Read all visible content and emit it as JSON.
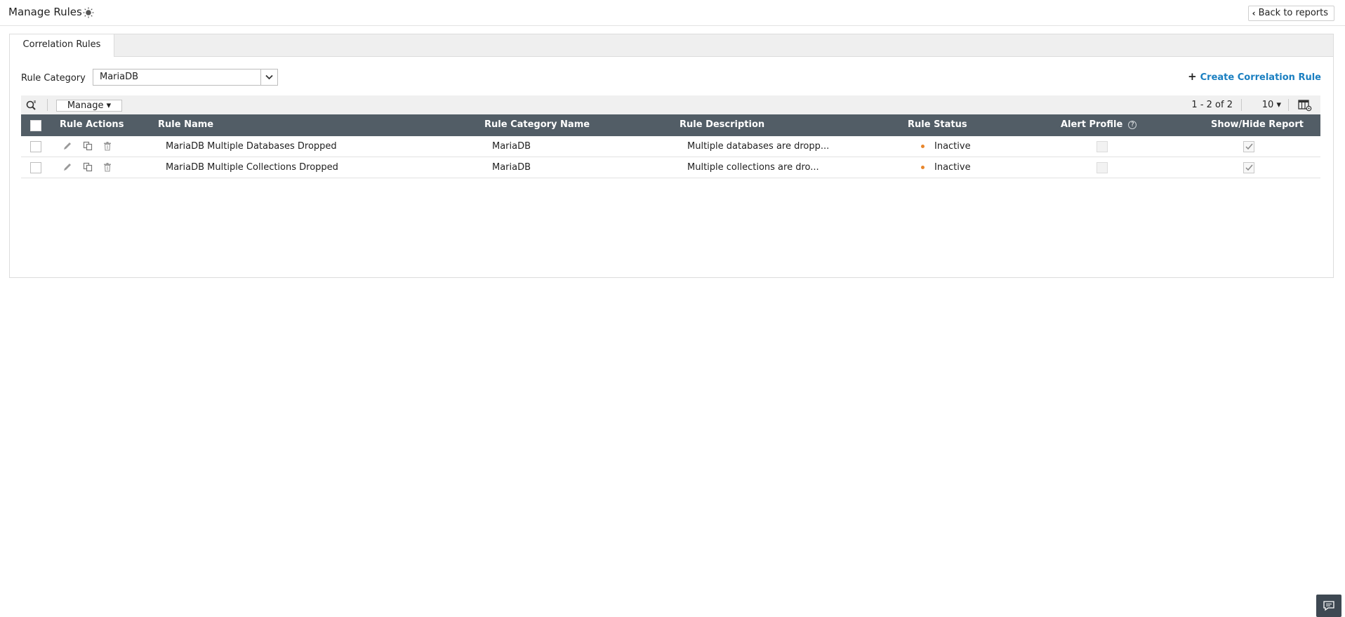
{
  "header": {
    "title": "Manage Rules",
    "back_label": "Back to reports"
  },
  "tabs": [
    {
      "label": "Correlation Rules",
      "active": true
    }
  ],
  "filter": {
    "label": "Rule Category",
    "selected": "MariaDB"
  },
  "create_label": "Create Correlation Rule",
  "toolbar": {
    "manage_label": "Manage",
    "pager": "1 - 2 of 2",
    "page_size": "10"
  },
  "table": {
    "columns": [
      "Rule Actions",
      "Rule Name",
      "Rule Category Name",
      "Rule Description",
      "Rule Status",
      "Alert Profile",
      "Show/Hide Report"
    ],
    "rows": [
      {
        "name": "MariaDB Multiple Databases Dropped",
        "category": "MariaDB",
        "description": "Multiple databases are dropp...",
        "status": "Inactive",
        "alert_profile": false,
        "show_report": true
      },
      {
        "name": "MariaDB Multiple Collections Dropped",
        "category": "MariaDB",
        "description": "Multiple collections are dro...",
        "status": "Inactive",
        "alert_profile": false,
        "show_report": true
      }
    ]
  },
  "icons": {
    "header": "lightbulb-icon",
    "row_actions": [
      "pencil-icon",
      "copy-icon",
      "trash-icon"
    ],
    "toolbar": [
      "search-icon",
      "columns-icon"
    ],
    "corner": "chat-icon"
  },
  "colors": {
    "table_header_bg": "#525d66",
    "link": "#1a7fc1",
    "status_inactive": "#e8862b"
  }
}
